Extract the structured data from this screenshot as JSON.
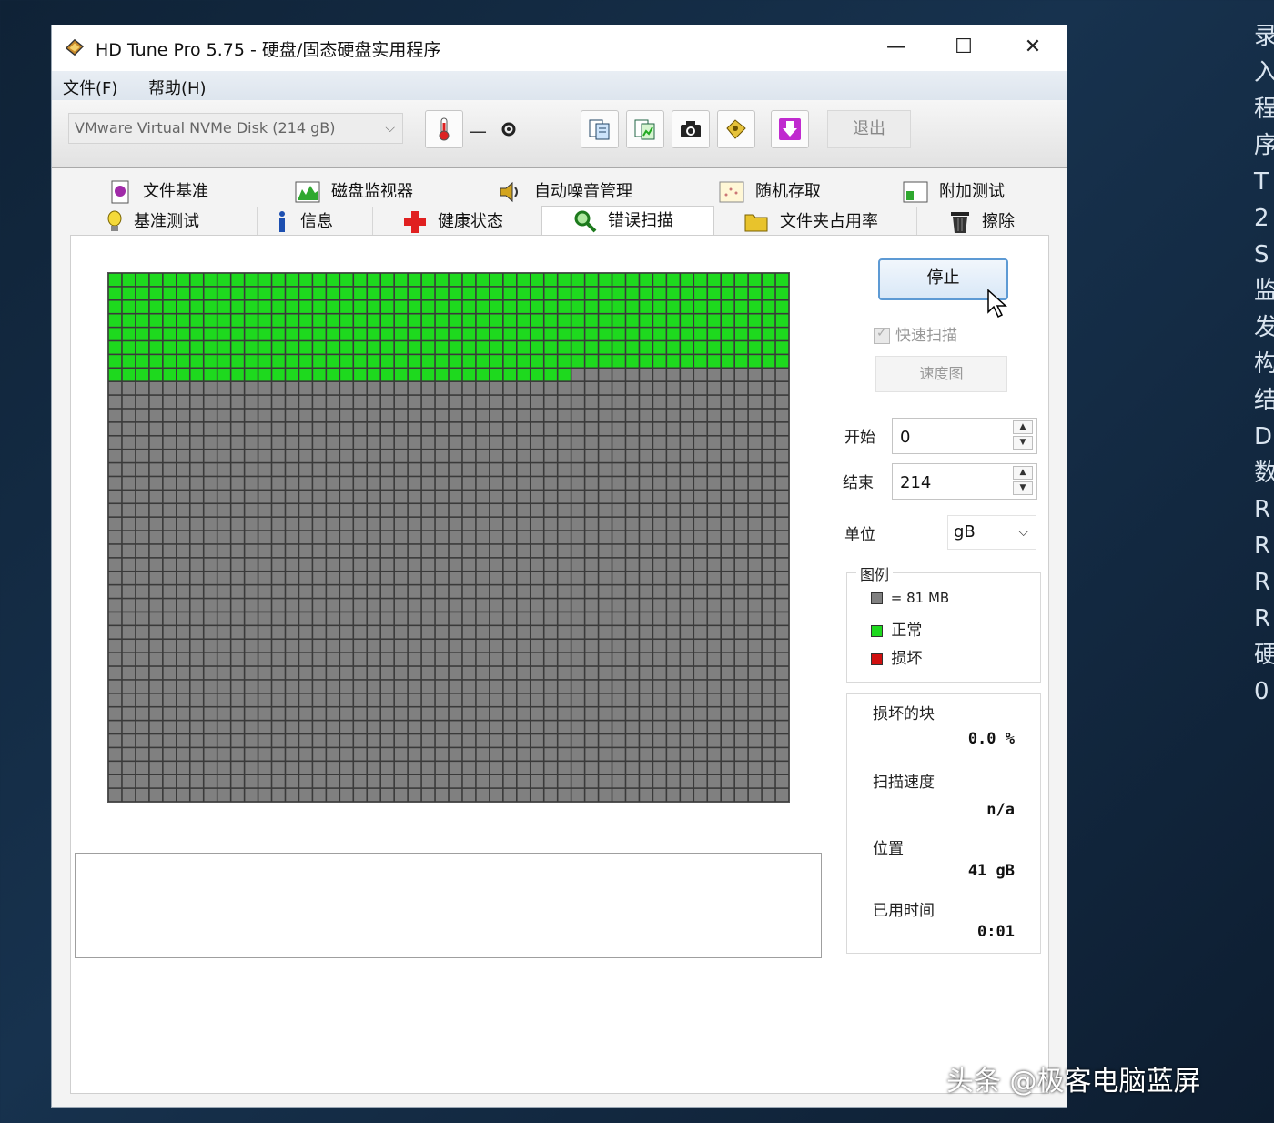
{
  "window": {
    "title": "HD Tune Pro 5.75 - 硬盘/固态硬盘实用程序",
    "minimize_label": "—",
    "maximize_label": "☐",
    "close_label": "✕"
  },
  "menu": {
    "file": "文件(F)",
    "help": "帮助(H)"
  },
  "toolbar": {
    "disk_selected": "VMware Virtual NVMe Disk (214 gB)",
    "temperature_value": "—",
    "exit_label": "退出",
    "icons": [
      "thermometer-icon",
      "copy-info-icon",
      "copy-results-icon",
      "screenshot-icon",
      "options-icon",
      "download-icon"
    ]
  },
  "tabs": {
    "row1": [
      "文件基准",
      "磁盘监视器",
      "自动噪音管理",
      "随机存取",
      "附加测试"
    ],
    "row2": [
      "基准测试",
      "信息",
      "健康状态",
      "错误扫描",
      "文件夹占用率",
      "擦除"
    ],
    "active": "错误扫描"
  },
  "scan": {
    "grid_cols": 50,
    "grid_rows": 39,
    "scanned_blocks": 384,
    "unscanned_color": "#808080",
    "ok_color": "#1ed91e",
    "bad_color": "#d01010"
  },
  "controls": {
    "stop_label": "停止",
    "quick_scan_label": "快速扫描",
    "speed_map_label": "速度图",
    "start_label": "开始",
    "start_value": "0",
    "end_label": "结束",
    "end_value": "214",
    "unit_label": "单位",
    "unit_value": "gB"
  },
  "legend": {
    "title": "图例",
    "block_size": "= 81 MB",
    "ok": "正常",
    "bad": "损坏"
  },
  "stats": {
    "damaged_label": "损坏的块",
    "damaged_value": "0.0 %",
    "speed_label": "扫描速度",
    "speed_value": "n/a",
    "position_label": "位置",
    "position_value": "41 gB",
    "elapsed_label": "已用时间",
    "elapsed_value": "0:01"
  },
  "watermark": "头条 @极客电脑蓝屏",
  "background_text": "录入程序T2S监发构结D数RRRR硬0"
}
